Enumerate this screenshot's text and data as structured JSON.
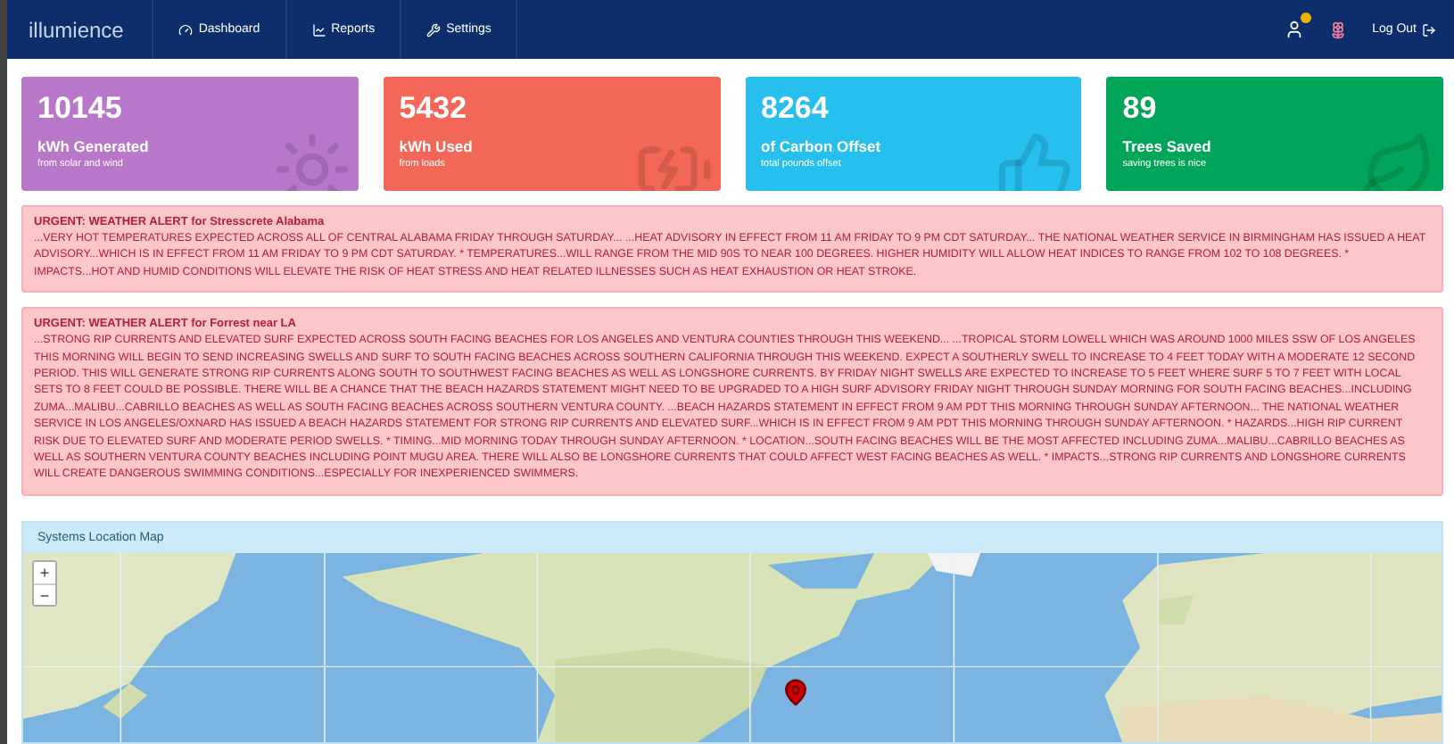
{
  "navbar": {
    "brand": "illumience",
    "items": [
      {
        "label": "Dashboard",
        "selected": false
      },
      {
        "label": "Reports",
        "selected": false
      },
      {
        "label": "Settings",
        "selected": false
      }
    ],
    "logout": "Log Out"
  },
  "stats": [
    {
      "value": "10145",
      "label": "kWh Generated",
      "sub": "from solar and wind",
      "color": "#b877c9"
    },
    {
      "value": "5432",
      "label": "kWh Used",
      "sub": "from loads",
      "color": "#f26757"
    },
    {
      "value": "8264",
      "label": "of Carbon Offset",
      "sub": "total pounds offset",
      "color": "#27bfee"
    },
    {
      "value": "89",
      "label": "Trees Saved",
      "sub": "saving trees is nice",
      "color": "#00a55a"
    }
  ],
  "alerts": [
    {
      "title": "URGENT: WEATHER ALERT for Stresscrete Alabama",
      "body": "...VERY HOT TEMPERATURES EXPECTED ACROSS ALL OF CENTRAL ALABAMA FRIDAY THROUGH SATURDAY... ...HEAT ADVISORY IN EFFECT FROM 11 AM FRIDAY TO 9 PM CDT SATURDAY... THE NATIONAL WEATHER SERVICE IN BIRMINGHAM HAS ISSUED A HEAT ADVISORY...WHICH IS IN EFFECT FROM 11 AM FRIDAY TO 9 PM CDT SATURDAY. * TEMPERATURES...WILL RANGE FROM THE MID 90S TO NEAR 100 DEGREES. HIGHER HUMIDITY WILL ALLOW HEAT INDICES TO RANGE FROM 102 TO 108 DEGREES. * IMPACTS...HOT AND HUMID CONDITIONS WILL ELEVATE THE RISK OF HEAT STRESS AND HEAT RELATED ILLNESSES SUCH AS HEAT EXHAUSTION OR HEAT STROKE."
    },
    {
      "title": "URGENT: WEATHER ALERT for Forrest near LA",
      "body": "...STRONG RIP CURRENTS AND ELEVATED SURF EXPECTED ACROSS SOUTH FACING BEACHES FOR LOS ANGELES AND VENTURA COUNTIES THROUGH THIS WEEKEND... ...TROPICAL STORM LOWELL WHICH WAS AROUND 1000 MILES SSW OF LOS ANGELES THIS MORNING WILL BEGIN TO SEND INCREASING SWELLS AND SURF TO SOUTH FACING BEACHES ACROSS SOUTHERN CALIFORNIA THROUGH THIS WEEKEND. EXPECT A SOUTHERLY SWELL TO INCREASE TO 4 FEET TODAY WITH A MODERATE 12 SECOND PERIOD. THIS WILL GENERATE STRONG RIP CURRENTS ALONG SOUTH TO SOUTHWEST FACING BEACHES AS WELL AS LONGSHORE CURRENTS. BY FRIDAY NIGHT SWELLS ARE EXPECTED TO INCREASE TO 5 FEET WHERE SURF 5 TO 7 FEET WITH LOCAL SETS TO 8 FEET COULD BE POSSIBLE. THERE WILL BE A CHANCE THAT THE BEACH HAZARDS STATEMENT MIGHT NEED TO BE UPGRADED TO A HIGH SURF ADVISORY FRIDAY NIGHT THROUGH SUNDAY MORNING FOR SOUTH FACING BEACHES...INCLUDING ZUMA...MALIBU...CABRILLO BEACHES AS WELL AS SOUTH FACING BEACHES ACROSS SOUTHERN VENTURA COUNTY. ...BEACH HAZARDS STATEMENT IN EFFECT FROM 9 AM PDT THIS MORNING THROUGH SUNDAY AFTERNOON... THE NATIONAL WEATHER SERVICE IN LOS ANGELES/OXNARD HAS ISSUED A BEACH HAZARDS STATEMENT FOR STRONG RIP CURRENTS AND ELEVATED SURF...WHICH IS IN EFFECT FROM 9 AM PDT THIS MORNING THROUGH SUNDAY AFTERNOON. * HAZARDS...HIGH RIP CURRENT RISK DUE TO ELEVATED SURF AND MODERATE PERIOD SWELLS. * TIMING...MID MORNING TODAY THROUGH SUNDAY AFTERNOON. * LOCATION...SOUTH FACING BEACHES WILL BE THE MOST AFFECTED INCLUDING ZUMA...MALIBU...CABRILLO BEACHES AS WELL AS SOUTHERN VENTURA COUNTY BEACHES INCLUDING POINT MUGU AREA. THERE WILL ALSO BE LONGSHORE CURRENTS THAT COULD AFFECT WEST FACING BEACHES AS WELL. * IMPACTS...STRONG RIP CURRENTS AND LONGSHORE CURRENTS WILL CREATE DANGEROUS SWIMMING CONDITIONS...ESPECIALLY FOR INEXPERIENCED SWIMMERS."
    }
  ],
  "map": {
    "title": "Systems Location Map",
    "zoom_in": "+",
    "zoom_out": "−",
    "kind": "picture"
  }
}
